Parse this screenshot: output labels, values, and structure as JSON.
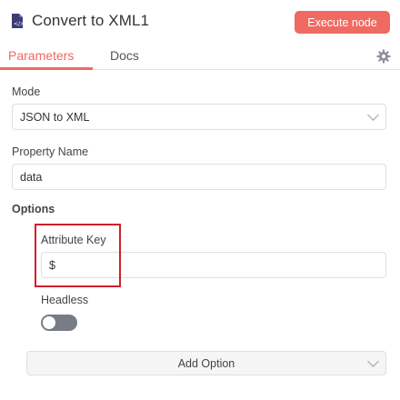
{
  "header": {
    "icon": "xml-file-icon",
    "title": "Convert to XML1",
    "execute_label": "Execute node",
    "accent_color": "#ef6a61"
  },
  "tabs": [
    {
      "label": "Parameters",
      "active": true
    },
    {
      "label": "Docs",
      "active": false
    }
  ],
  "settings_icon": "gear-icon",
  "parameters": {
    "mode": {
      "label": "Mode",
      "value": "JSON to XML"
    },
    "property_name": {
      "label": "Property Name",
      "value": "data"
    },
    "options_label": "Options",
    "attribute_key": {
      "label": "Attribute Key",
      "value": "$"
    },
    "headless": {
      "label": "Headless",
      "enabled": false
    },
    "add_option_label": "Add Option"
  }
}
